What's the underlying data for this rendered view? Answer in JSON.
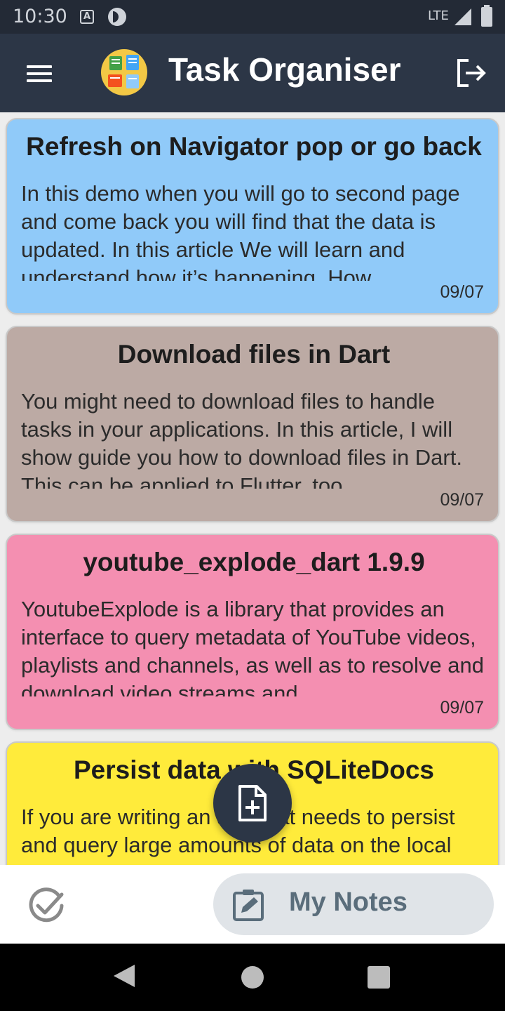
{
  "status_bar": {
    "time": "10:30",
    "network": "LTE",
    "notification_icons": [
      "a-notification-icon",
      "p-notification-icon"
    ]
  },
  "app_bar": {
    "title": "Task Organiser",
    "menu_icon": "menu-icon",
    "logo_icon": "task-organiser-logo-icon",
    "logout_icon": "logout-icon"
  },
  "notes": [
    {
      "title": "Refresh on Navigator pop or go back",
      "body": "In this demo when you will go to second page and come back you will find that the data is updated. In this article We will learn and understand how it’s happening. How",
      "date": "09/07",
      "color": "#90caf9"
    },
    {
      "title": "Download files in Dart",
      "body": "You might need to download files to handle tasks in your applications. In this article, I will show guide you how to download files in Dart. This can be applied to Flutter, too.",
      "date": "09/07",
      "color": "#bcaaa4"
    },
    {
      "title": "youtube_explode_dart 1.9.9",
      "body": "YoutubeExplode is a library that provides an interface to query metadata of YouTube videos, playlists and channels, as well as to resolve and download video streams and",
      "date": "09/07",
      "color": "#f48fb1"
    },
    {
      "title": "Persist data with SQLiteDocs",
      "body": "If you are writing an app that needs to persist and query large amounts of data on the local device, consider using a database",
      "date": "",
      "color": "#ffeb3b"
    }
  ],
  "fab": {
    "icon": "add-note-icon"
  },
  "bottom_nav": {
    "tasks_icon": "check-circle-icon",
    "notes_icon": "edit-note-icon",
    "notes_label": "My Notes",
    "active_bg": "#e0e4e8",
    "active_color": "#5a6d7b"
  },
  "colors": {
    "app_bar": "#2c3646",
    "status_bar": "#232a36",
    "background": "#ededed"
  }
}
